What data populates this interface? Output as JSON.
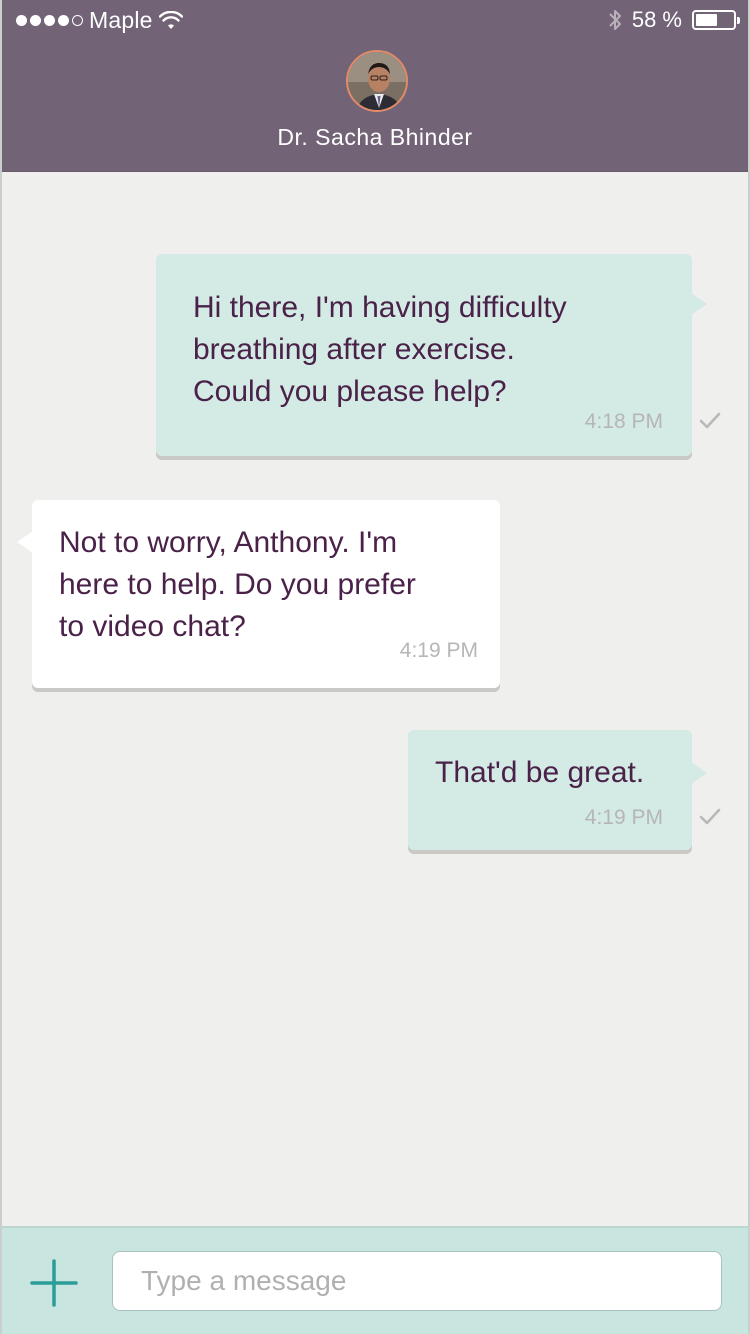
{
  "status_bar": {
    "carrier": "Maple",
    "signal_filled": 4,
    "signal_total": 5,
    "battery_percent_label": "58 %",
    "battery_level": 0.58,
    "icons": [
      "wifi-icon",
      "bluetooth-icon",
      "battery-icon"
    ]
  },
  "header": {
    "doctor_name": "Dr. Sacha Bhinder",
    "avatar_icon": "doctor-avatar"
  },
  "messages": [
    {
      "direction": "outgoing",
      "text": "Hi there, I'm having difficulty\nbreathing after exercise.\nCould you please help?",
      "time": "4:18 PM",
      "status_icon": "check-icon"
    },
    {
      "direction": "incoming",
      "text": "Not to worry, Anthony. I'm\nhere to help. Do you prefer\nto video chat?",
      "time": "4:19 PM"
    },
    {
      "direction": "outgoing",
      "text": "That'd be great.",
      "time": "4:19 PM",
      "status_icon": "check-icon"
    }
  ],
  "composer": {
    "add_icon": "plus-icon",
    "placeholder": "Type a message",
    "value": ""
  },
  "colors": {
    "header_bg": "#726476",
    "outgoing_bubble": "#d3eae5",
    "incoming_bubble": "#ffffff",
    "message_text": "#4a2148",
    "composer_bg": "#c9e5df",
    "accent": "#2a9d98"
  }
}
